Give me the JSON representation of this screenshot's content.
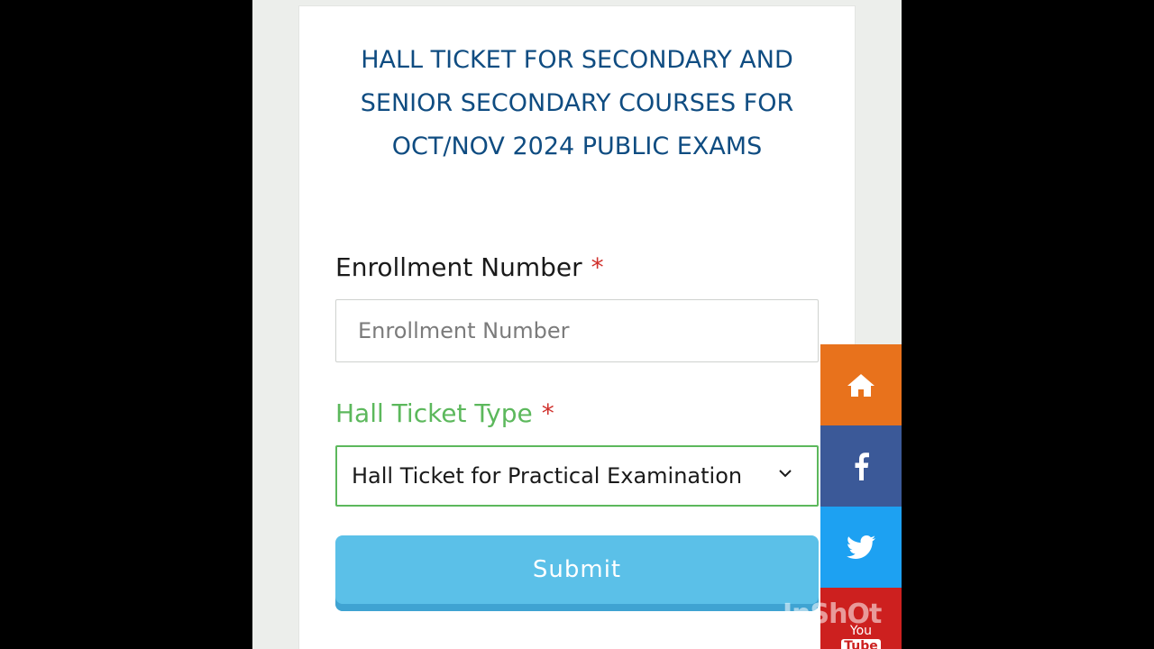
{
  "form": {
    "title": "HALL TICKET FOR SECONDARY AND SENIOR SECONDARY COURSES FOR OCT/NOV 2024 PUBLIC EXAMS",
    "enrollment_label": "Enrollment Number",
    "enrollment_required": "*",
    "enrollment_placeholder": "Enrollment Number",
    "enrollment_value": "",
    "type_label": "Hall Ticket Type",
    "type_required": "*",
    "type_selected": "Hall Ticket for Practical Examination",
    "submit_label": "Submit"
  },
  "social": {
    "items": [
      {
        "icon": "home-icon",
        "color": "#e8721c"
      },
      {
        "icon": "facebook-icon",
        "color": "#3b5998"
      },
      {
        "icon": "twitter-icon",
        "color": "#1da1f2"
      },
      {
        "icon": "youtube-icon",
        "color": "#cd201f"
      }
    ],
    "youtube_you": "You",
    "youtube_tube": "Tube"
  },
  "watermark": "InShOt",
  "colors": {
    "title": "#0f4c81",
    "required": "#d0312d",
    "valid": "#5cb85c",
    "submit": "#5bc0e8"
  }
}
